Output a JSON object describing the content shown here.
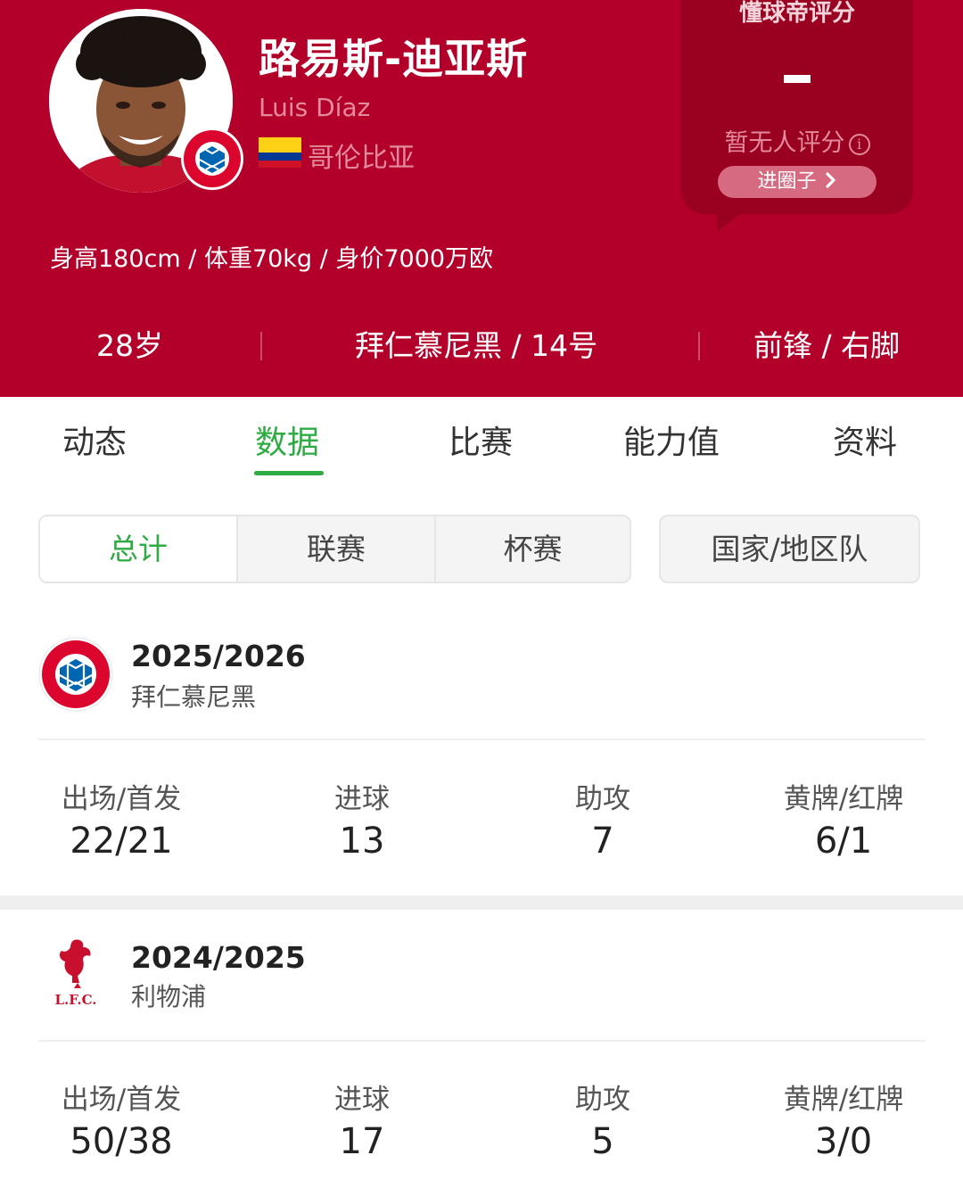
{
  "player": {
    "name_cn": "路易斯-迪亚斯",
    "name_en": "Luis Díaz",
    "nationality": "哥伦比亚",
    "body_info": "身高180cm / 体重70kg / 身价7000万欧",
    "age": "28岁",
    "club_number": "拜仁慕尼黑 / 14号",
    "position_foot": "前锋 / 右脚"
  },
  "rating": {
    "title": "懂球帝评分",
    "value": "-",
    "none_text": "暂无人评分",
    "info_icon": "info-icon",
    "button_label": "进圈子",
    "button_icon": "chevron-right-icon"
  },
  "tabs": [
    {
      "label": "动态",
      "active": false
    },
    {
      "label": "数据",
      "active": true
    },
    {
      "label": "比赛",
      "active": false
    },
    {
      "label": "能力值",
      "active": false
    },
    {
      "label": "资料",
      "active": false
    }
  ],
  "filters": {
    "segments": [
      "总计",
      "联赛",
      "杯赛"
    ],
    "active": "总计",
    "national": "国家/地区队"
  },
  "seasons": [
    {
      "year": "2025/2026",
      "club": "拜仁慕尼黑",
      "logo_icon": "bayern-munich-logo",
      "stats": [
        {
          "label": "出场/首发",
          "value": "22/21"
        },
        {
          "label": "进球",
          "value": "13"
        },
        {
          "label": "助攻",
          "value": "7"
        },
        {
          "label": "黄牌/红牌",
          "value": "6/1"
        }
      ]
    },
    {
      "year": "2024/2025",
      "club": "利物浦",
      "logo_icon": "liverpool-logo",
      "logo_text": "L.F.C.",
      "stats": [
        {
          "label": "出场/首发",
          "value": "50/38"
        },
        {
          "label": "进球",
          "value": "17"
        },
        {
          "label": "助攻",
          "value": "5"
        },
        {
          "label": "黄牌/红牌",
          "value": "3/0"
        }
      ]
    }
  ],
  "colors": {
    "header_red": "#b3002a",
    "rating_card": "#9a001f",
    "accent_green": "#2eab42"
  }
}
